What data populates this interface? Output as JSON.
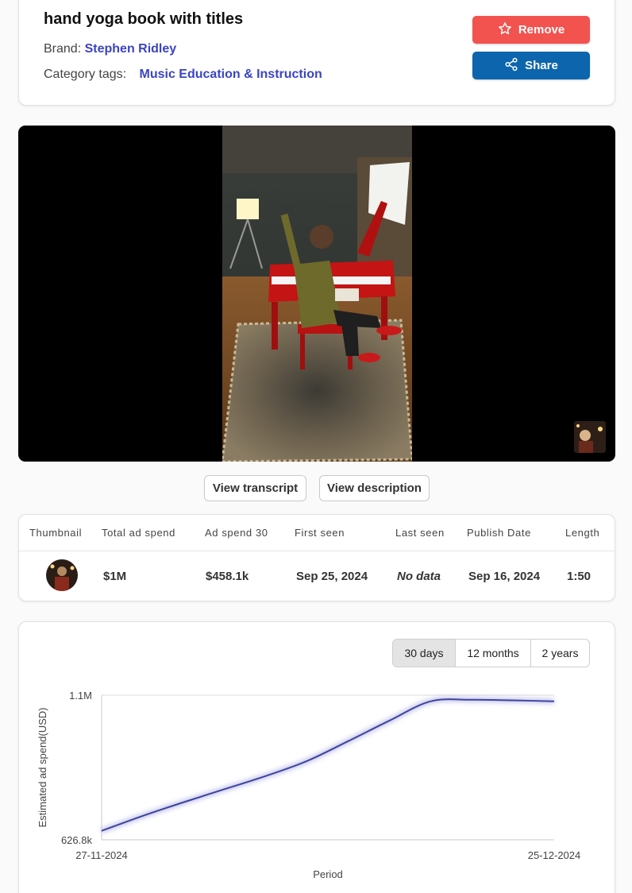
{
  "header": {
    "title": "hand yoga book with titles",
    "brand_label": "Brand:",
    "brand_value": "Stephen Ridley",
    "category_label": "Category tags:",
    "category_value": "Music Education & Instruction",
    "remove_label": "Remove",
    "share_label": "Share",
    "remove_icon": "star-icon",
    "share_icon": "share-icon"
  },
  "video": {
    "buttons": {
      "transcript": "View transcript",
      "description": "View description"
    }
  },
  "stats": {
    "headers": [
      "Thumbnail",
      "Total ad spend",
      "Ad spend 30",
      "First seen",
      "Last seen",
      "Publish Date",
      "Length"
    ],
    "row": {
      "total_ad_spend": "$1M",
      "ad_spend_30": "$458.1k",
      "first_seen": "Sep 25, 2024",
      "last_seen": "No data",
      "publish_date": "Sep 16, 2024",
      "length": "1:50"
    }
  },
  "range_toggle": {
    "options": [
      "30 days",
      "12 months",
      "2 years"
    ],
    "selected": "30 days"
  },
  "colors": {
    "remove": "#f2534f",
    "share": "#0c65ad",
    "link": "#3b44c4",
    "line": "#3f44a0"
  },
  "chart_data": {
    "type": "line",
    "xlabel": "Period",
    "ylabel": "Estimated ad spend(USD)",
    "x_ticks": [
      "27-11-2024",
      "25-12-2024"
    ],
    "y_ticks": [
      "626.8k",
      "1.1M"
    ],
    "ylim": [
      626800,
      1100000
    ],
    "x": [
      "27-11-2024",
      "30-11-2024",
      "03-12-2024",
      "06-12-2024",
      "09-12-2024",
      "12-12-2024",
      "15-12-2024",
      "18-12-2024",
      "21-12-2024",
      "22-12-2024",
      "24-12-2024",
      "25-12-2024"
    ],
    "values": [
      656000,
      705000,
      750000,
      793000,
      836000,
      885000,
      950000,
      1017000,
      1080000,
      1085000,
      1083000,
      1080000
    ],
    "grid": "horizontal"
  }
}
